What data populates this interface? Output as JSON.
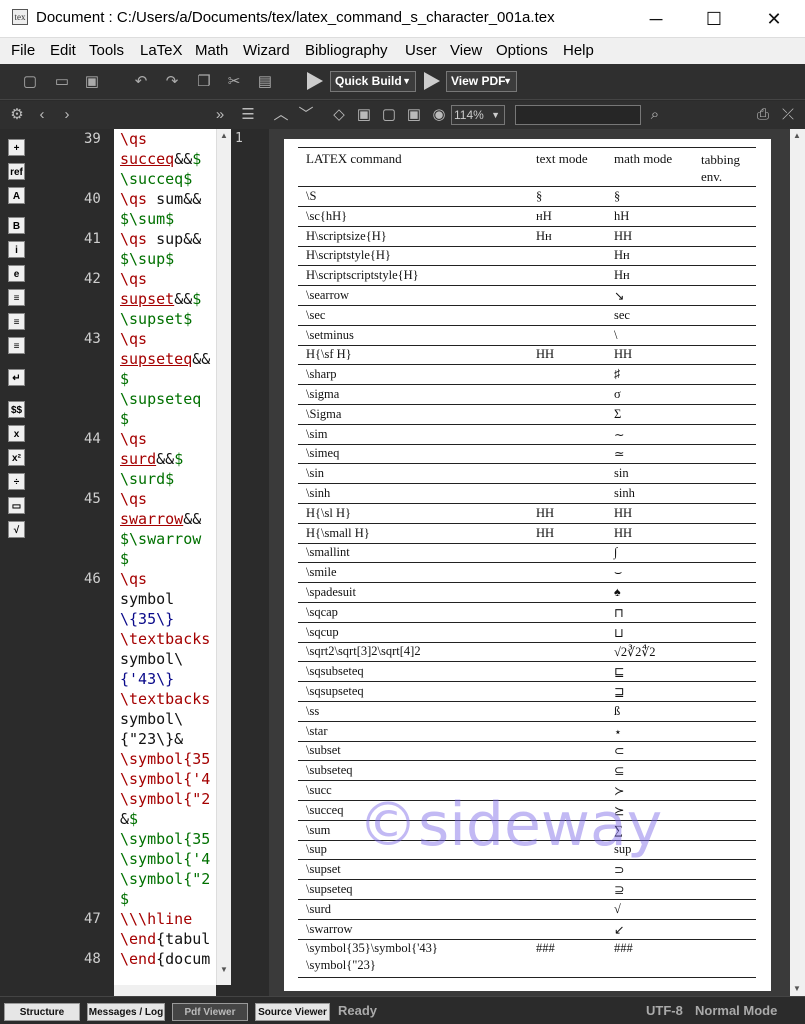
{
  "window": {
    "title": "Document : C:/Users/a/Documents/tex/latex_command_s_character_001a.tex",
    "minimize": "─",
    "maximize": "☐",
    "close": "✕",
    "app_icon": "tex"
  },
  "menu": [
    "File",
    "Edit",
    "Tools",
    "LaTeX",
    "Math",
    "Wizard",
    "Bibliography",
    "User",
    "View",
    "Options",
    "Help"
  ],
  "toolbar": {
    "quick_build": "Quick Build",
    "view_pdf": "View PDF"
  },
  "pdf_toolbar": {
    "zoom": "114%"
  },
  "left_icons": [
    "+",
    "ref",
    "A",
    "B",
    "i",
    "e",
    "≡",
    "≡",
    "≡",
    "↵",
    "$$",
    "x",
    "x²",
    "÷",
    "▭",
    "√"
  ],
  "editor": {
    "line_numbers": [
      {
        "n": "39",
        "row": 0
      },
      {
        "n": "40",
        "row": 3
      },
      {
        "n": "41",
        "row": 5
      },
      {
        "n": "42",
        "row": 7
      },
      {
        "n": "43",
        "row": 10
      },
      {
        "n": "44",
        "row": 15
      },
      {
        "n": "45",
        "row": 18
      },
      {
        "n": "46",
        "row": 22
      },
      {
        "n": "47",
        "row": 39
      },
      {
        "n": "48",
        "row": 41
      }
    ],
    "lines": [
      [
        [
          "red",
          "\\qs"
        ]
      ],
      [
        [
          "ul",
          "succeq"
        ],
        [
          "blk",
          "&&"
        ],
        [
          "grn",
          "$"
        ]
      ],
      [
        [
          "grn",
          "\\succeq$"
        ]
      ],
      [
        [
          "red",
          "\\qs"
        ],
        [
          "blk",
          " sum&&"
        ]
      ],
      [
        [
          "grn",
          "$\\sum$"
        ]
      ],
      [
        [
          "red",
          "\\qs"
        ],
        [
          "blk",
          " sup&&"
        ]
      ],
      [
        [
          "grn",
          "$\\sup$"
        ]
      ],
      [
        [
          "red",
          "\\qs"
        ]
      ],
      [
        [
          "ul",
          "supset"
        ],
        [
          "blk",
          "&&"
        ],
        [
          "grn",
          "$"
        ]
      ],
      [
        [
          "grn",
          "\\supset$"
        ]
      ],
      [
        [
          "red",
          "\\qs"
        ]
      ],
      [
        [
          "ul",
          "supseteq"
        ],
        [
          "blk",
          "&&"
        ]
      ],
      [
        [
          "grn",
          "$"
        ]
      ],
      [
        [
          "grn",
          "\\supseteq"
        ]
      ],
      [
        [
          "grn",
          "$"
        ]
      ],
      [
        [
          "red",
          "\\qs"
        ]
      ],
      [
        [
          "ul",
          "surd"
        ],
        [
          "blk",
          "&&"
        ],
        [
          "grn",
          "$"
        ]
      ],
      [
        [
          "grn",
          "\\surd$"
        ]
      ],
      [
        [
          "red",
          "\\qs"
        ]
      ],
      [
        [
          "ul",
          "swarrow"
        ],
        [
          "blk",
          "&&"
        ]
      ],
      [
        [
          "grn",
          "$\\swarrow"
        ]
      ],
      [
        [
          "grn",
          "$"
        ]
      ],
      [
        [
          "red",
          "\\qs"
        ]
      ],
      [
        [
          "blk",
          "symbol"
        ]
      ],
      [
        [
          "blu",
          "\\{35\\}"
        ]
      ],
      [
        [
          "red",
          "\\textbacks"
        ]
      ],
      [
        [
          "blk",
          "symbol\\"
        ]
      ],
      [
        [
          "blu",
          "{'43\\}"
        ]
      ],
      [
        [
          "red",
          "\\textbacks"
        ]
      ],
      [
        [
          "blk",
          "symbol\\"
        ]
      ],
      [
        [
          "blk",
          "{\"23\\}&"
        ]
      ],
      [
        [
          "red",
          "\\symbol{35"
        ]
      ],
      [
        [
          "red",
          "\\symbol{'4"
        ]
      ],
      [
        [
          "red",
          "\\symbol{\"2"
        ]
      ],
      [
        [
          "blk",
          "&"
        ],
        [
          "grn",
          "$"
        ]
      ],
      [
        [
          "grn",
          "\\symbol{35"
        ]
      ],
      [
        [
          "grn",
          "\\symbol{'4"
        ]
      ],
      [
        [
          "grn",
          "\\symbol{\"2"
        ]
      ],
      [
        [
          "grn",
          "$"
        ]
      ],
      [
        [
          "red",
          "\\\\\\hline"
        ]
      ],
      [
        [
          "red",
          "\\end"
        ],
        [
          "blk",
          "{tabul"
        ]
      ],
      [
        [
          "red",
          "\\end"
        ],
        [
          "blk",
          "{docum"
        ]
      ]
    ]
  },
  "pdf_page_number": "1",
  "pdf_table": {
    "headers": [
      "LATEX command",
      "text mode",
      "math mode",
      "tabbing env."
    ],
    "rows": [
      [
        "\\S",
        "§",
        "§"
      ],
      [
        "\\sc{hH}",
        "ʜH",
        "hH"
      ],
      [
        "H\\scriptsize{H}",
        "Hʜ",
        "HH"
      ],
      [
        "H\\scriptstyle{H}",
        "",
        "Hʜ"
      ],
      [
        "H\\scriptscriptstyle{H}",
        "",
        "Hʜ"
      ],
      [
        "\\searrow",
        "",
        "↘"
      ],
      [
        "\\sec",
        "",
        "sec"
      ],
      [
        "\\setminus",
        "",
        "\\"
      ],
      [
        "H{\\sf H}",
        "HH",
        "HH"
      ],
      [
        "\\sharp",
        "",
        "♯"
      ],
      [
        "\\sigma",
        "",
        "σ"
      ],
      [
        "\\Sigma",
        "",
        "Σ"
      ],
      [
        "\\sim",
        "",
        "∼"
      ],
      [
        "\\simeq",
        "",
        "≃"
      ],
      [
        "\\sin",
        "",
        "sin"
      ],
      [
        "\\sinh",
        "",
        "sinh"
      ],
      [
        "H{\\sl H}",
        "HH",
        "HH"
      ],
      [
        "H{\\small H}",
        "HH",
        "HH"
      ],
      [
        "\\smallint",
        "",
        "∫"
      ],
      [
        "\\smile",
        "",
        "⌣"
      ],
      [
        "\\spadesuit",
        "",
        "♠"
      ],
      [
        "\\sqcap",
        "",
        "⊓"
      ],
      [
        "\\sqcup",
        "",
        "⊔"
      ],
      [
        "\\sqrt2\\sqrt[3]2\\sqrt[4]2",
        "",
        "√2∛2∜2"
      ],
      [
        "\\sqsubseteq",
        "",
        "⊑"
      ],
      [
        "\\sqsupseteq",
        "",
        "⊒"
      ],
      [
        "\\ss",
        "",
        "ß"
      ],
      [
        "\\star",
        "",
        "⋆"
      ],
      [
        "\\subset",
        "",
        "⊂"
      ],
      [
        "\\subseteq",
        "",
        "⊆"
      ],
      [
        "\\succ",
        "",
        "≻"
      ],
      [
        "\\succeq",
        "",
        "⪰"
      ],
      [
        "\\sum",
        "",
        "∑"
      ],
      [
        "\\sup",
        "",
        "sup"
      ],
      [
        "\\supset",
        "",
        "⊃"
      ],
      [
        "\\supseteq",
        "",
        "⊇"
      ],
      [
        "\\surd",
        "",
        "√"
      ],
      [
        "\\swarrow",
        "",
        "↙"
      ],
      [
        "\\symbol{35}\\symbol{'43}",
        "###",
        "###"
      ]
    ],
    "last_row_extra": "\\symbol{\"23}"
  },
  "watermark": "©sideway",
  "status": {
    "tabs": [
      "Structure",
      "Messages / Log",
      "Pdf Viewer",
      "Source Viewer"
    ],
    "active_tab": "Pdf Viewer",
    "ready": "Ready",
    "encoding": "UTF-8",
    "mode": "Normal Mode"
  }
}
